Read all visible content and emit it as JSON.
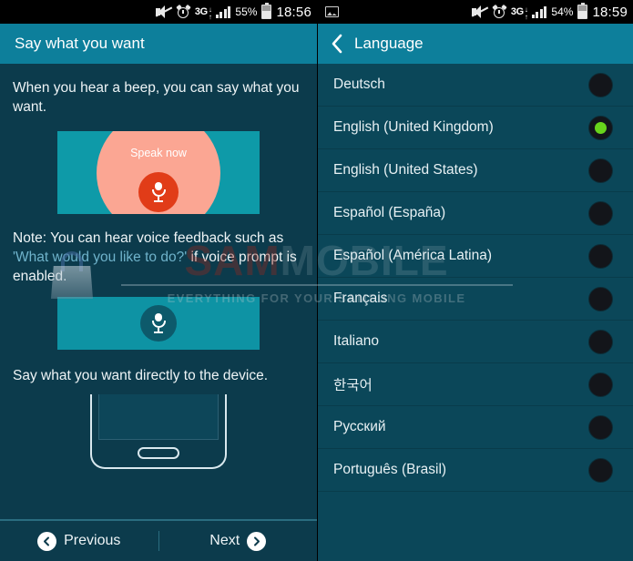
{
  "left": {
    "status_bar": {
      "icons": [
        "mute-icon",
        "alarm-icon",
        "3g-icon",
        "signal-icon",
        "battery-icon"
      ],
      "network": "3G",
      "battery_percent": "55%",
      "time": "18:56"
    },
    "header": {
      "title": "Say what you want"
    },
    "intro_text": "When you hear a beep, you can say what you want.",
    "graphic_speak": {
      "caption": "Speak now",
      "icon": "microphone-icon"
    },
    "note": {
      "prefix": "Note: You can hear voice feedback such as ",
      "quote": "'What would you like to do?'",
      "suffix": " if voice prompt is enabled."
    },
    "graphic_mic": {
      "icon": "microphone-icon"
    },
    "device_text": "Say what you want directly to the device.",
    "phone_art": {
      "icon": "phone-outline-icon",
      "waves": "sound-waves"
    },
    "nav": {
      "previous_label": "Previous",
      "previous_icon": "chevron-left-circle-icon",
      "next_label": "Next",
      "next_icon": "chevron-right-circle-icon"
    }
  },
  "right": {
    "status_bar": {
      "left_icon": "image-icon",
      "icons": [
        "mute-icon",
        "alarm-icon",
        "3g-icon",
        "signal-icon",
        "battery-icon"
      ],
      "network": "3G",
      "battery_percent": "54%",
      "time": "18:59"
    },
    "header": {
      "title": "Language",
      "back_icon": "chevron-left-icon"
    },
    "languages": [
      {
        "label": "Deutsch",
        "selected": false
      },
      {
        "label": "English (United Kingdom)",
        "selected": true
      },
      {
        "label": "English (United States)",
        "selected": false
      },
      {
        "label": "Español (España)",
        "selected": false
      },
      {
        "label": "Español (América Latina)",
        "selected": false
      },
      {
        "label": "Français",
        "selected": false
      },
      {
        "label": "Italiano",
        "selected": false
      },
      {
        "label": "한국어",
        "selected": false
      },
      {
        "label": "Русский",
        "selected": false
      },
      {
        "label": "Português (Brasil)",
        "selected": false
      }
    ]
  },
  "watermark": {
    "brand_part1": "SAM",
    "brand_part2": "MOBILE",
    "tagline": "EVERYTHING FOR YOUR SAMSUNG MOBILE"
  },
  "colors": {
    "header_teal": "#0d7f9b",
    "body_dark": "#0c3b4c",
    "accent_green": "#68d41c",
    "mic_red": "#e13c18",
    "halo_salmon": "#fba693",
    "graphic_teal": "#0e9aa8"
  }
}
